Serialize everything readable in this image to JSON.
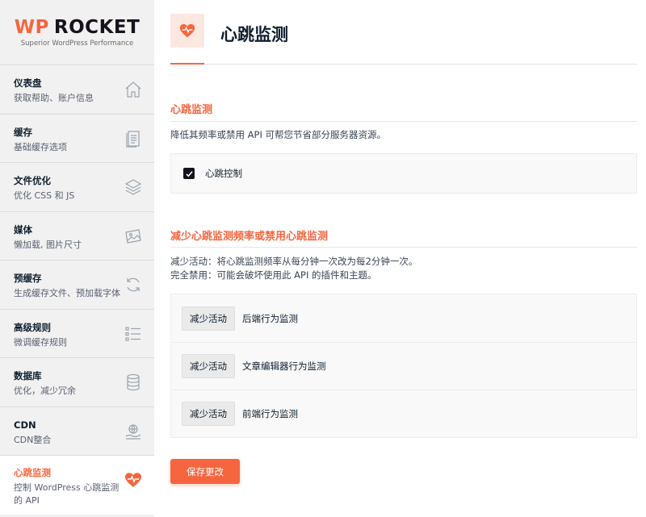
{
  "brand": {
    "wp": "WP",
    "rocket": "ROCKET",
    "tagline": "Superior WordPress Performance",
    "accent": "#f56640"
  },
  "sidebar": {
    "items": [
      {
        "title": "仪表盘",
        "subtitle": "获取帮助、账户信息",
        "icon": "home-icon"
      },
      {
        "title": "缓存",
        "subtitle": "基础缓存选项",
        "icon": "document-icon"
      },
      {
        "title": "文件优化",
        "subtitle": "优化 CSS 和 JS",
        "icon": "layers-icon"
      },
      {
        "title": "媒体",
        "subtitle": "懒加载, 图片尺寸",
        "icon": "image-icon"
      },
      {
        "title": "预缓存",
        "subtitle": "生成缓存文件、预加载字体",
        "icon": "refresh-icon"
      },
      {
        "title": "高级规则",
        "subtitle": "微调缓存规则",
        "icon": "list-icon"
      },
      {
        "title": "数据库",
        "subtitle": "优化，减少冗余",
        "icon": "database-icon"
      },
      {
        "title": "CDN",
        "subtitle": "CDN整合",
        "icon": "globe-hand-icon"
      },
      {
        "title": "心跳监测",
        "subtitle": "控制 WordPress 心跳监测的 API",
        "icon": "heartbeat-icon",
        "active": true
      }
    ]
  },
  "page": {
    "title": "心跳监测",
    "icon": "heartbeat-icon"
  },
  "section1": {
    "title": "心跳监测",
    "description": "降低其频率或禁用 API 可帮您节省部分服务器资源。",
    "checkbox_label": "心跳控制",
    "checkbox_checked": true
  },
  "section2": {
    "title": "减少心跳监测频率或禁用心跳监测",
    "description_line1": "减少活动：将心跳监测频率从每分钟一次改为每2分钟一次。",
    "description_line2": "完全禁用：可能会破坏使用此 API 的插件和主题。",
    "rows": [
      {
        "button": "减少活动",
        "label": "后端行为监测"
      },
      {
        "button": "减少活动",
        "label": "文章编辑器行为监测"
      },
      {
        "button": "减少活动",
        "label": "前端行为监测"
      }
    ]
  },
  "save_button": "保存更改"
}
